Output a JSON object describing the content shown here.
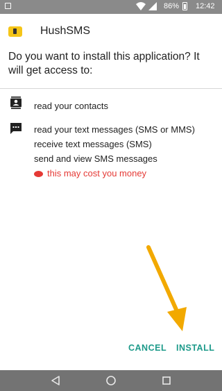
{
  "status_bar": {
    "battery": "86%",
    "time": "12:42"
  },
  "header": {
    "app_name": "HushSMS",
    "question": "Do you want to install this application? It will get access to:"
  },
  "permissions": {
    "contacts": [
      "read your contacts"
    ],
    "messages": [
      "read your text messages (SMS or MMS)",
      "receive text messages (SMS)",
      "send and view SMS messages"
    ],
    "cost_warning": "this may cost you money"
  },
  "actions": {
    "cancel": "CANCEL",
    "install": "INSTALL"
  },
  "colors": {
    "accent": "#1d9a8a",
    "warning": "#e53935",
    "annotation_arrow": "#f2a900"
  },
  "icons": {
    "contacts": "contacts-icon",
    "messages": "message-icon",
    "cost": "money-icon",
    "wifi": "wifi-icon",
    "signal": "signal-icon",
    "battery": "battery-icon",
    "back": "back-icon",
    "home": "home-icon",
    "recents": "recents-icon"
  }
}
